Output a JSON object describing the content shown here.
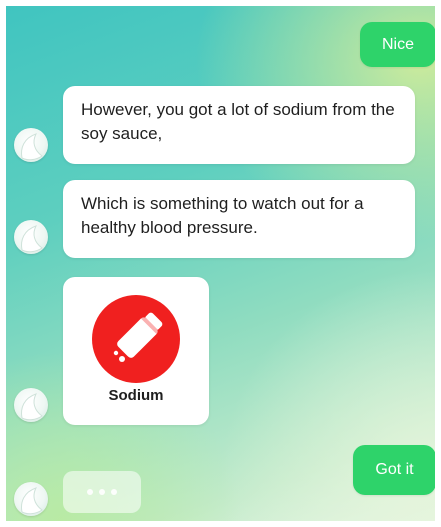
{
  "messages": {
    "user_1": "Nice",
    "bot_1": "However, you got a lot of sodium from the soy sauce,",
    "bot_2": "Which is something to watch out for a healthy blood pressure.",
    "card": {
      "label": "Sodium",
      "icon": "salt-shaker-icon",
      "color": "#f0201f"
    },
    "user_2": "Got it"
  },
  "colors": {
    "user_bubble": "#2ed36a",
    "bot_bubble": "#ffffff"
  },
  "typing_indicator": {
    "icon": "typing-dots-icon"
  }
}
